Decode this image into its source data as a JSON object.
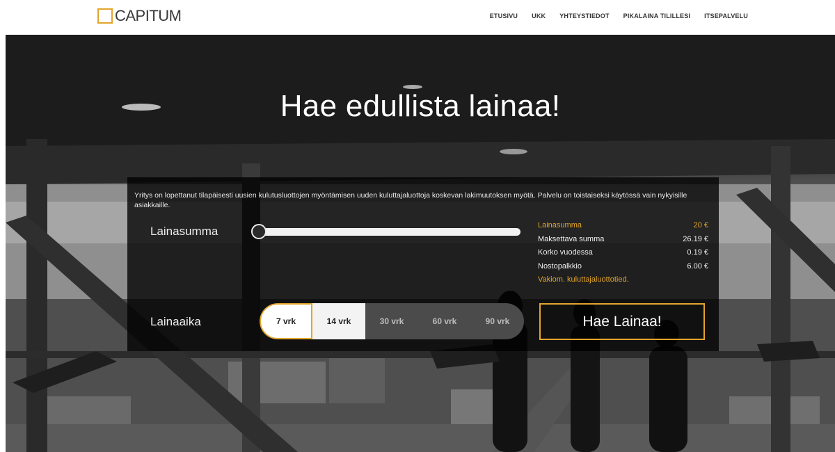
{
  "brand": {
    "name": "CAPITUM",
    "accent": "#e3a52a"
  },
  "nav": [
    {
      "label": "ETUSIVU"
    },
    {
      "label": "UKK"
    },
    {
      "label": "YHTEYSTIEDOT"
    },
    {
      "label": "PIKALAINA TILILLESI"
    },
    {
      "label": "ITSEPALVELU"
    }
  ],
  "hero": {
    "title": "Hae edullista lainaa!"
  },
  "loan": {
    "notice": "Yritys on lopettanut tilapäisesti uusien kulutusluottojen myöntämisen uuden kuluttajaluottoja koskevan lakimuutoksen myötä. Palvelu on toistaiseksi käytössä vain nykyisille asiakkaille.",
    "amount_label": "Lainasumma",
    "slider_level": 0,
    "summary": {
      "rows": [
        {
          "label": "Lainasumma",
          "value": "20 €",
          "accent": true
        },
        {
          "label": "Maksettava summa",
          "value": "26.19 €"
        },
        {
          "label": "Korko vuodessa",
          "value": "0.19 €"
        },
        {
          "label": "Nostopalkkio",
          "value": "6.00 €"
        }
      ],
      "link": "Vakiom. kuluttajaluottotied."
    },
    "term_label": "Lainaaika",
    "terms": [
      {
        "label": "7 vrk",
        "selected": true
      },
      {
        "label": "14 vrk"
      },
      {
        "label": "30 vrk"
      },
      {
        "label": "60 vrk"
      },
      {
        "label": "90 vrk"
      }
    ],
    "apply_label": "Hae Lainaa!"
  }
}
